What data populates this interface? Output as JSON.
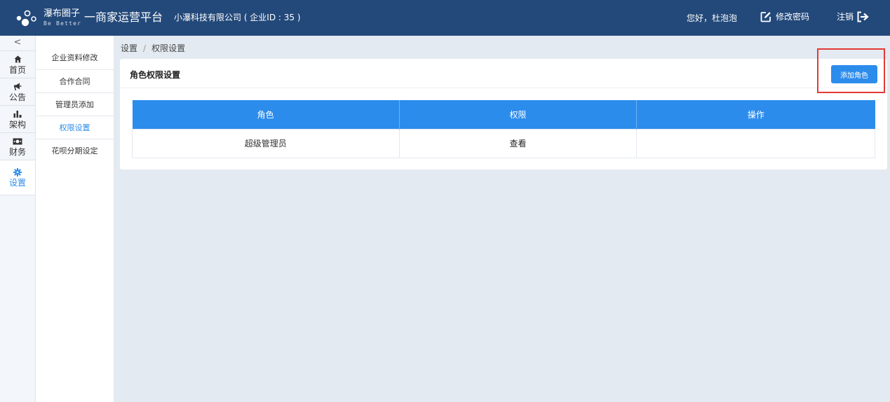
{
  "header": {
    "brand_name": "瀑布圈子",
    "brand_tagline": "Be Better",
    "title": "一商家运营平台",
    "company": "小瀑科技有限公司 ( 企业ID : 35 )",
    "greeting": "您好，杜泡泡",
    "change_password": "修改密码",
    "logout": "注销",
    "colors": {
      "bar": "#23497a",
      "accent": "#2c8cec"
    }
  },
  "rail": {
    "toggle": "<",
    "items": [
      {
        "label": "首页",
        "icon": "home-icon"
      },
      {
        "label": "公告",
        "icon": "megaphone-icon"
      },
      {
        "label": "架构",
        "icon": "bar-chart-icon"
      },
      {
        "label": "财务",
        "icon": "money-icon"
      },
      {
        "label": "设置",
        "icon": "gear-icon",
        "active": true
      }
    ]
  },
  "submenu": {
    "items": [
      {
        "label": "企业资料修改"
      },
      {
        "label": "合作合同"
      },
      {
        "label": "管理员添加"
      },
      {
        "label": "权限设置",
        "active": true
      },
      {
        "label": "花呗分期设定"
      }
    ]
  },
  "breadcrumb": {
    "parent": "设置",
    "separator": "/",
    "current": "权限设置"
  },
  "card": {
    "title": "角色权限设置",
    "add_button": "添加角色"
  },
  "table": {
    "columns": [
      "角色",
      "权限",
      "操作"
    ],
    "rows": [
      {
        "role": "超级管理员",
        "permission": "查看",
        "action": ""
      }
    ]
  }
}
